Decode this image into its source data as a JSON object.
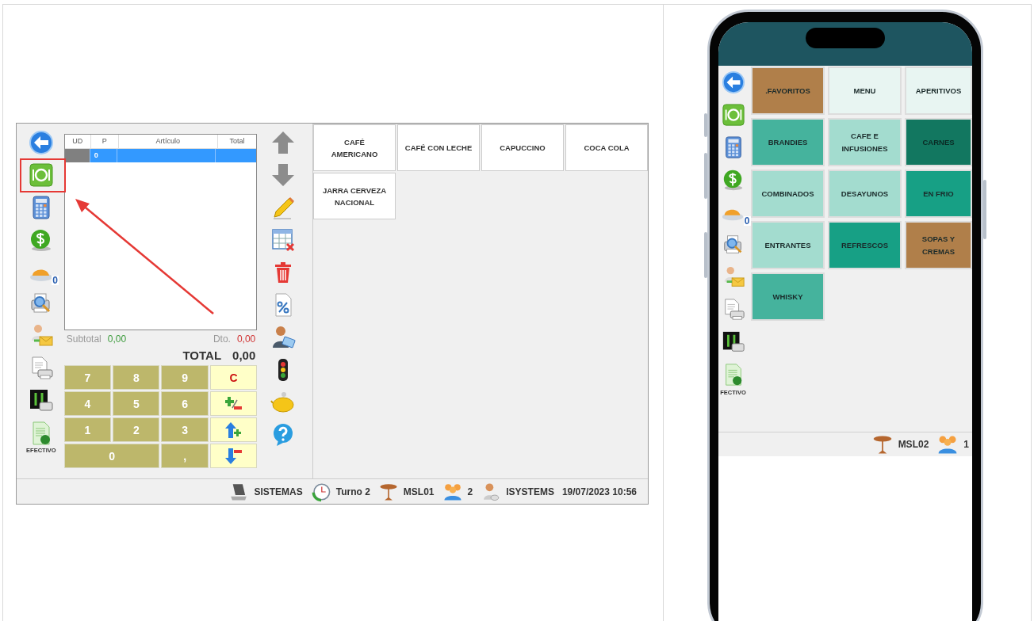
{
  "pos": {
    "cash_label": "EFECTIVO",
    "dish_count": "0",
    "ticket": {
      "columns": [
        "UD",
        "P",
        "Artículo",
        "Total"
      ],
      "rows": [
        {
          "p": "0",
          "selected": true
        }
      ]
    },
    "subtotal_label": "Subtotal",
    "subtotal": "0,00",
    "discount_label": "Dto.",
    "discount": "0,00",
    "total_label": "TOTAL",
    "total": "0,00",
    "keypad": [
      {
        "kind": "digit",
        "label": "7",
        "wide": false
      },
      {
        "kind": "digit",
        "label": "8",
        "wide": false
      },
      {
        "kind": "digit",
        "label": "9",
        "wide": false
      },
      {
        "kind": "clear",
        "label": "C",
        "wide": false
      },
      {
        "kind": "digit",
        "label": "4",
        "wide": false
      },
      {
        "kind": "digit",
        "label": "5",
        "wide": false
      },
      {
        "kind": "digit",
        "label": "6",
        "wide": false
      },
      {
        "kind": "sign",
        "wide": false
      },
      {
        "kind": "digit",
        "label": "1",
        "wide": false
      },
      {
        "kind": "digit",
        "label": "2",
        "wide": false
      },
      {
        "kind": "digit",
        "label": "3",
        "wide": false
      },
      {
        "kind": "line-up",
        "wide": false
      },
      {
        "kind": "digit",
        "label": "0",
        "wide": true
      },
      {
        "kind": "digit",
        "label": ",",
        "wide": false
      },
      {
        "kind": "line-down",
        "wide": false
      }
    ],
    "products": [
      "CAFÉ AMERICANO",
      "CAFÉ CON LECHE",
      "CAPUCCINO",
      "COCA COLA",
      "JARRA CERVEZA NACIONAL"
    ],
    "status_bar": [
      {
        "kind": "terminal",
        "text": "SISTEMAS"
      },
      {
        "kind": "shift",
        "text": "Turno 2"
      },
      {
        "kind": "table",
        "text": "MSL01"
      },
      {
        "kind": "guests",
        "text": "2"
      },
      {
        "kind": "user",
        "text": "ISYSTEMS"
      },
      {
        "kind": "datetime",
        "text": "19/07/2023 10:56"
      }
    ]
  },
  "phone": {
    "cash_label": "FECTIVO",
    "dish_count": "0",
    "categories": [
      {
        "label": ".FAVORITOS",
        "color": "#b07f4a"
      },
      {
        "label": "MENU",
        "color": "#e8f5f2"
      },
      {
        "label": "APERITIVOS",
        "color": "#e8f5f2"
      },
      {
        "label": "BRANDIES",
        "color": "#45b39d"
      },
      {
        "label": "CAFE E INFUSIONES",
        "color": "#a3dccf"
      },
      {
        "label": "CARNES",
        "color": "#127760"
      },
      {
        "label": "COMBINADOS",
        "color": "#a3dccf"
      },
      {
        "label": "DESAYUNOS",
        "color": "#a3dccf"
      },
      {
        "label": "EN FRIO",
        "color": "#17a085"
      },
      {
        "label": "ENTRANTES",
        "color": "#a3dccf"
      },
      {
        "label": "REFRESCOS",
        "color": "#17a085"
      },
      {
        "label": "SOPAS Y CREMAS",
        "color": "#b07f4a"
      },
      {
        "label": "WHISKY",
        "color": "#45b39d"
      }
    ],
    "status_bar": [
      {
        "kind": "table",
        "text": "MSL02"
      },
      {
        "kind": "guests",
        "text": "1"
      }
    ]
  }
}
